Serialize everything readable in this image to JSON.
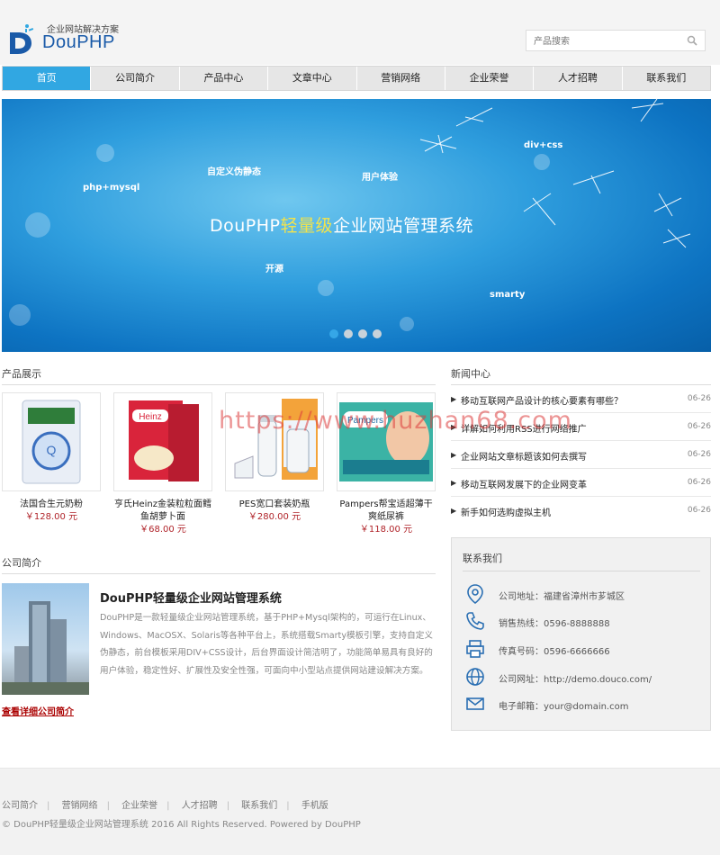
{
  "header": {
    "logo_tagline": "企业网站解决方案",
    "logo_name": "DouPHP",
    "search_placeholder": "产品搜索"
  },
  "nav": [
    "首页",
    "公司简介",
    "产品中心",
    "文章中心",
    "营销网络",
    "企业荣誉",
    "人才招聘",
    "联系我们"
  ],
  "banner": {
    "title_pre": "DouPHP",
    "title_hl": "轻量级",
    "title_post": "企业网站管理系统",
    "keywords": [
      "php+mysql",
      "自定义伪静态",
      "用户体验",
      "div+css",
      "开源",
      "smarty"
    ],
    "slide_count": 4,
    "active_slide": 1
  },
  "products": {
    "title": "产品展示",
    "items": [
      {
        "name": "法国合生元奶粉",
        "price": "￥128.00 元"
      },
      {
        "name": "亨氏Heinz金装粒粒面鳕鱼胡萝卜面",
        "price": "￥68.00 元"
      },
      {
        "name": "PES宽口套装奶瓶",
        "price": "￥280.00 元"
      },
      {
        "name": "Pampers帮宝适超薄干爽纸尿裤",
        "price": "￥118.00 元"
      }
    ]
  },
  "news": {
    "title": "新闻中心",
    "items": [
      {
        "title": "移动互联网产品设计的核心要素有哪些？",
        "date": "06-26"
      },
      {
        "title": "详解如何利用RSS进行网络推广",
        "date": "06-26"
      },
      {
        "title": "企业网站文章标题该如何去撰写",
        "date": "06-26"
      },
      {
        "title": "移动互联网发展下的企业网变革",
        "date": "06-26"
      },
      {
        "title": "新手如何选购虚拟主机",
        "date": "06-26"
      }
    ]
  },
  "intro": {
    "title": "公司简介",
    "heading": "DouPHP轻量级企业网站管理系统",
    "text": "DouPHP是一款轻量级企业网站管理系统，基于PHP+Mysql架构的，可运行在Linux、Windows、MacOSX、Solaris等各种平台上，系统搭载Smarty模板引擎，支持自定义伪静态，前台模板采用DIV+CSS设计，后台界面设计简洁明了，功能简单易具有良好的用户体验，稳定性好、扩展性及安全性强，可面向中小型站点提供网站建设解决方案。",
    "more": "查看详细公司简介"
  },
  "contact": {
    "title": "联系我们",
    "rows": [
      {
        "icon": "map-pin-icon",
        "text": "公司地址：福建省漳州市芗城区"
      },
      {
        "icon": "phone-icon",
        "text": "销售热线：0596-8888888"
      },
      {
        "icon": "printer-icon",
        "text": "传真号码：0596-6666666"
      },
      {
        "icon": "globe-icon",
        "text": "公司网址：http://demo.douco.com/"
      },
      {
        "icon": "mail-icon",
        "text": "电子邮箱：your@domain.com"
      }
    ]
  },
  "footer": {
    "links": [
      "公司简介",
      "营销网络",
      "企业荣誉",
      "人才招聘",
      "联系我们",
      "手机版"
    ],
    "copyright": "© DouPHP轻量级企业网站管理系统 2016 All Rights Reserved. Powered by DouPHP"
  },
  "watermark": "https://www.huzhan68.com",
  "colors": {
    "accent": "#31a7e2",
    "brand": "#1a5aa8",
    "price": "#b0242a"
  }
}
